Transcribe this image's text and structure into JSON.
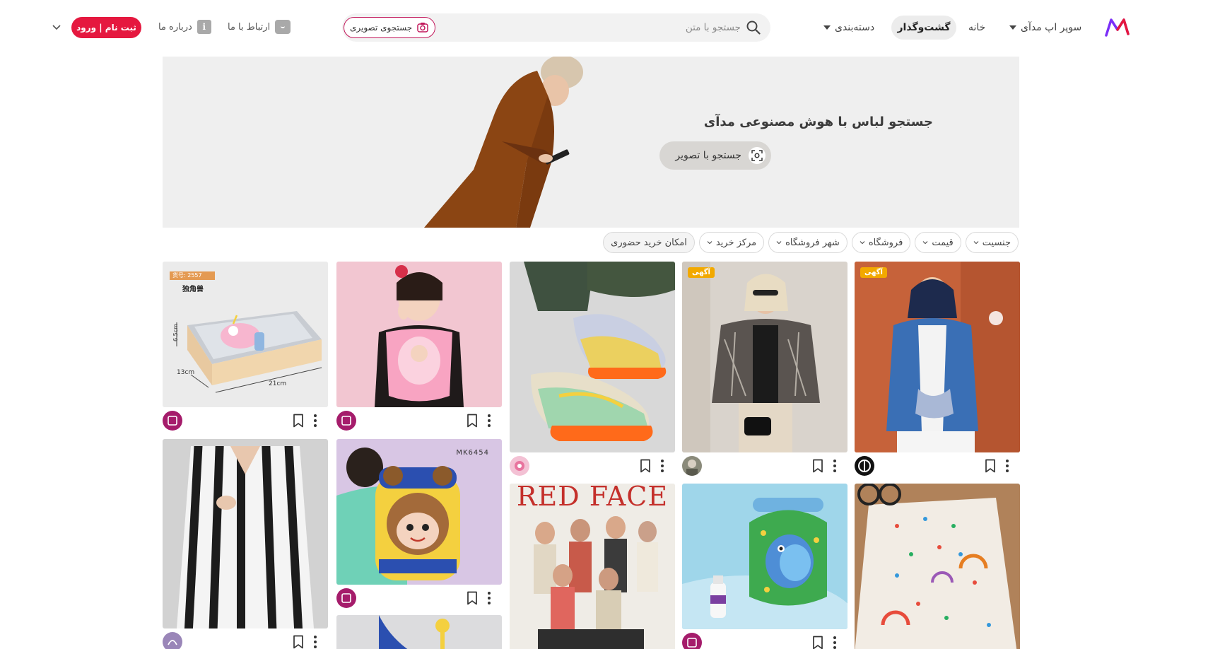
{
  "header": {
    "nav_super_app": "سوپر اپ مدآی",
    "nav_home": "خانه",
    "nav_browse": "گشت‌وگذار",
    "nav_category": "دسته‌بندی",
    "search_placeholder": "جستجو با متن",
    "image_search_label": "جستجوی تصویری",
    "contact_label": "ارتباط با ما",
    "about_label": "درباره ما",
    "login_label": "ثبت نام | ورود"
  },
  "banner": {
    "title": "جستجو لباس با هوش مصنوعی مدآی",
    "button_label": "جستجو با تصویر"
  },
  "filters": [
    {
      "label": "جنسیت",
      "has_dropdown": true
    },
    {
      "label": "قیمت",
      "has_dropdown": true
    },
    {
      "label": "فروشگاه",
      "has_dropdown": true
    },
    {
      "label": "شهر فروشگاه",
      "has_dropdown": true
    },
    {
      "label": "مرکز خرید",
      "has_dropdown": true
    },
    {
      "label": "امکان خرید حضوری",
      "has_dropdown": false
    }
  ],
  "products": {
    "ad_badge": "آگهی",
    "lunchbox_tag": "独角兽",
    "lunchbox_code": "货号: 2557",
    "lunchbox_dims": [
      "6.5cm",
      "13cm",
      "21cm"
    ],
    "backpack_code": "MK6454",
    "poster_headline": "RED FACE"
  },
  "colors": {
    "accent": "#e5183f",
    "image_search_border": "#c2185b",
    "browse_pill": "#ececec",
    "ad_badge": "#f2a900"
  }
}
